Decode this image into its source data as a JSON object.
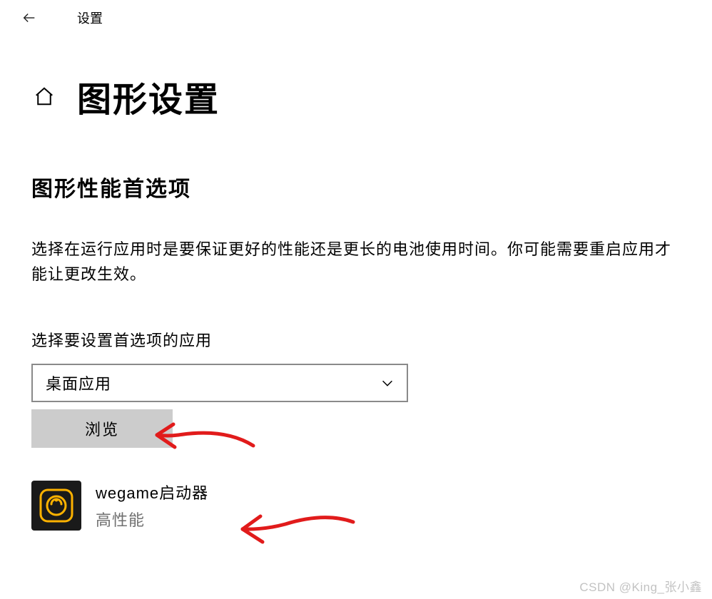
{
  "topbar": {
    "title": "设置"
  },
  "header": {
    "title": "图形设置"
  },
  "section": {
    "heading": "图形性能首选项",
    "description": "选择在运行应用时是要保证更好的性能还是更长的电池使用时间。你可能需要重启应用才能让更改生效。",
    "field_label": "选择要设置首选项的应用",
    "dropdown_value": "桌面应用",
    "browse_label": "浏览"
  },
  "app": {
    "name": "wegame启动器",
    "status": "高性能"
  },
  "watermark": "CSDN @King_张小鑫",
  "colors": {
    "accent": "#fdb200",
    "annotation": "#e11b1b"
  }
}
